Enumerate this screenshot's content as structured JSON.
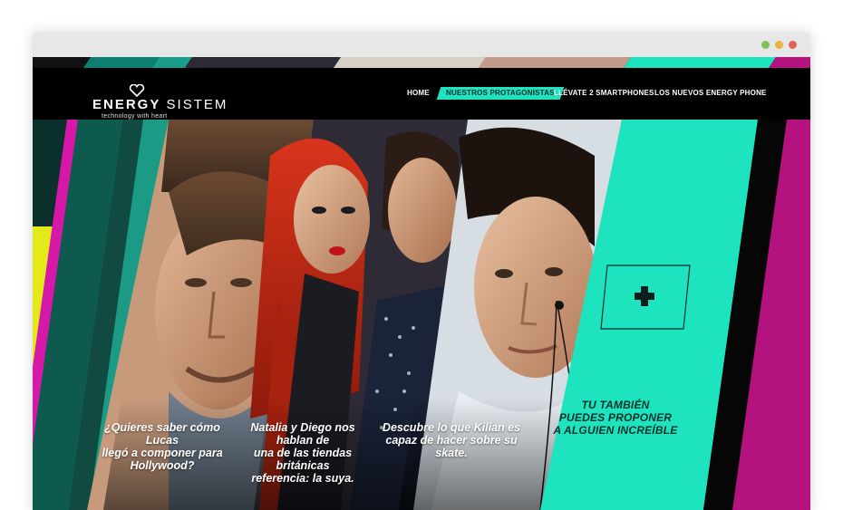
{
  "window": {
    "dots": [
      "#7fc25b",
      "#e8b341",
      "#e06456"
    ]
  },
  "brand": {
    "name_part1": "ENERGY",
    "name_part2": " SISTEM",
    "tagline": "technology with heart"
  },
  "nav": {
    "items": [
      {
        "label": "HOME"
      },
      {
        "label": "NUESTROS PROTAGONISTAS"
      },
      {
        "label": "LLÉVATE 2 SMARTPHONES"
      },
      {
        "label": "LOS NUEVOS ENERGY PHONE"
      }
    ],
    "active_index": 1
  },
  "panels": [
    {
      "caption_line1": "¿Quieres saber cómo Lucas",
      "caption_line2": "llegó a componer para",
      "caption_line3": "Hollywood?"
    },
    {
      "caption_line1": "Natalia y Diego nos hablan de",
      "caption_line2": "una de las tiendas británicas",
      "caption_line3": "referencia: la suya."
    },
    {
      "caption_line1": "Descubre lo que Kilian es",
      "caption_line2": "capaz de hacer sobre su skate."
    }
  ],
  "cta": {
    "line1": "TU TAMBIÉN",
    "line2": "PUEDES PROPONER",
    "line3": "A ALGUIEN INCREÍBLE"
  },
  "colors": {
    "accent": "#1de3be",
    "magenta": "#b3127f",
    "yellow": "#e4ea1a",
    "dark_teal": "#0b2f2a"
  }
}
